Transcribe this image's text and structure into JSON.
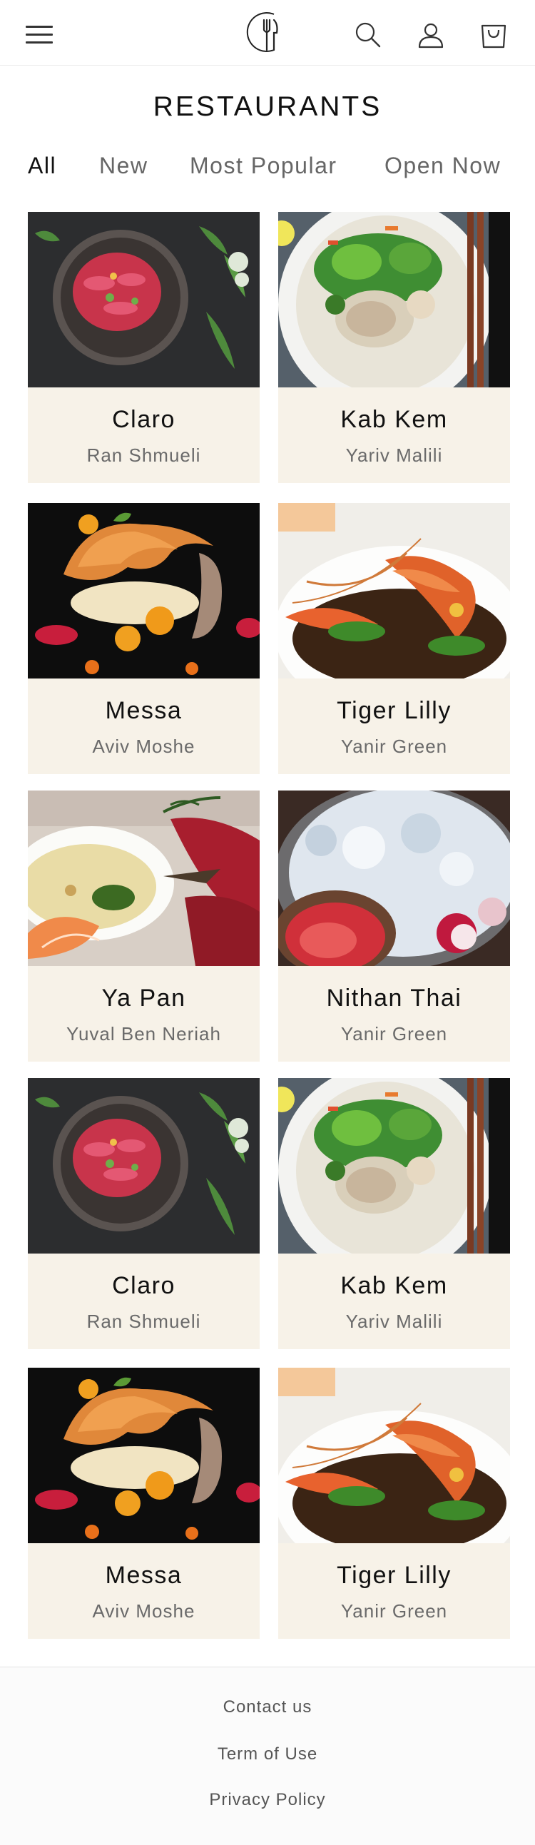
{
  "header": {
    "menu_icon": "hamburger-menu-icon",
    "logo_icon": "fork-knife-logo-icon",
    "search_icon": "search-icon",
    "user_icon": "user-icon",
    "cart_icon": "shopping-bag-icon"
  },
  "page": {
    "title": "RESTAURANTS"
  },
  "tabs": [
    {
      "label": "All",
      "active": true
    },
    {
      "label": "New",
      "active": false
    },
    {
      "label": "Most Popular",
      "active": false
    },
    {
      "label": "Open Now",
      "active": false
    }
  ],
  "restaurants": [
    {
      "name": "Claro",
      "chef": "Ran Shmueli",
      "image": "sashimi-bowl-photo"
    },
    {
      "name": "Kab Kem",
      "chef": "Yariv Malili",
      "image": "noodle-salad-bowl-photo"
    },
    {
      "name": "Messa",
      "chef": "Aviv Moshe",
      "image": "plated-dessert-photo"
    },
    {
      "name": "Tiger Lilly",
      "chef": "Yanir Green",
      "image": "shrimp-dish-photo"
    },
    {
      "name": "Ya Pan",
      "chef": "Yuval Ben Neriah",
      "image": "sashimi-platter-photo"
    },
    {
      "name": "Nithan Thai",
      "chef": "Yanir Green",
      "image": "iced-tuna-photo"
    },
    {
      "name": "Claro",
      "chef": "Ran Shmueli",
      "image": "sashimi-bowl-photo"
    },
    {
      "name": "Kab Kem",
      "chef": "Yariv Malili",
      "image": "noodle-salad-bowl-photo"
    },
    {
      "name": "Messa",
      "chef": "Aviv Moshe",
      "image": "plated-dessert-photo"
    },
    {
      "name": "Tiger Lilly",
      "chef": "Yanir Green",
      "image": "shrimp-dish-photo"
    }
  ],
  "footer": {
    "links": [
      "Contact us",
      "Term of Use",
      "Privacy Policy"
    ]
  },
  "colors": {
    "card_background": "#f7f2e8",
    "text_primary": "#111111",
    "text_secondary": "#6a6a6a"
  }
}
